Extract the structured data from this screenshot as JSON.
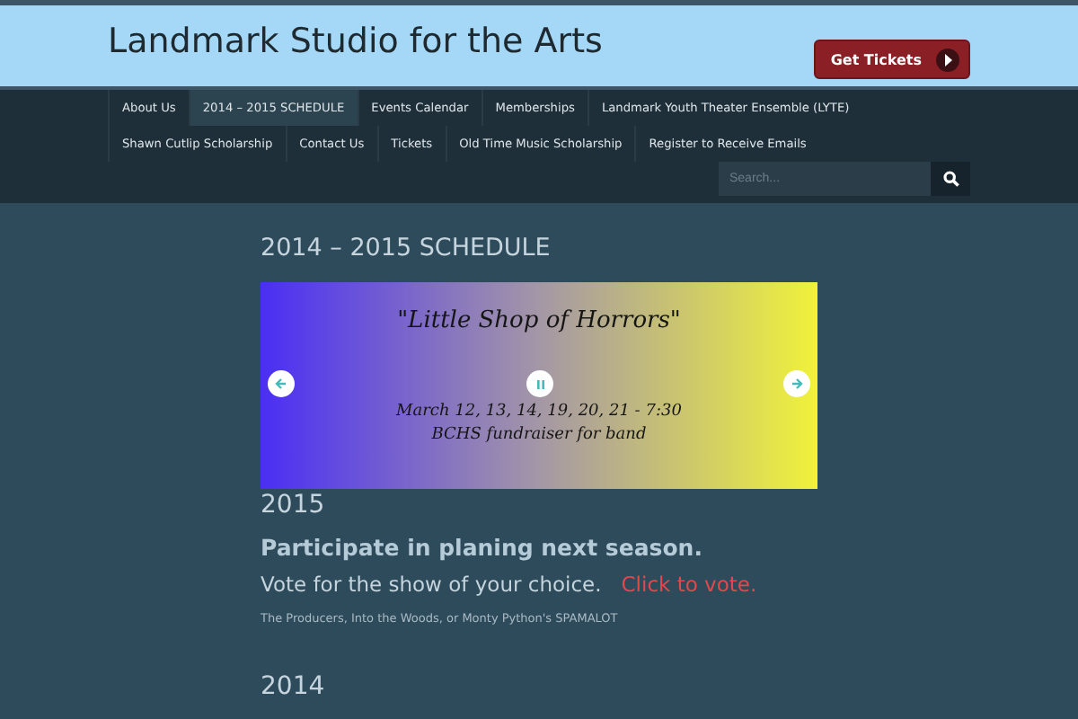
{
  "site_title": "Landmark Studio for the Arts",
  "cta_button": {
    "label": "Get Tickets"
  },
  "nav": [
    {
      "label": "About Us",
      "selected": false
    },
    {
      "label": "2014 – 2015 SCHEDULE",
      "selected": true
    },
    {
      "label": "Events Calendar",
      "selected": false
    },
    {
      "label": "Memberships",
      "selected": false
    },
    {
      "label": "Landmark Youth Theater Ensemble (LYTE)",
      "selected": false
    },
    {
      "label": "Shawn Cutlip Scholarship",
      "selected": false
    },
    {
      "label": "Contact Us",
      "selected": false
    },
    {
      "label": "Tickets",
      "selected": false
    },
    {
      "label": "Old Time Music Scholarship",
      "selected": false
    },
    {
      "label": "Register to Receive Emails",
      "selected": false
    }
  ],
  "search": {
    "placeholder": "Search..."
  },
  "page_title": "2014 – 2015 SCHEDULE",
  "slide": {
    "title": "\"Little Shop of Horrors\"",
    "lines": [
      "March 12, 13, 14, 19, 20, 21   -   7:30",
      "BCHS fundraiser for band"
    ]
  },
  "sections": [
    {
      "heading": "2015",
      "lead": "Participate in planing next season.",
      "text": "Vote for the show of your choice.",
      "link": "Click to vote.",
      "note": "The Producers, Into the Woods, or Monty Python's SPAMALOT"
    },
    {
      "heading": "2014"
    }
  ]
}
